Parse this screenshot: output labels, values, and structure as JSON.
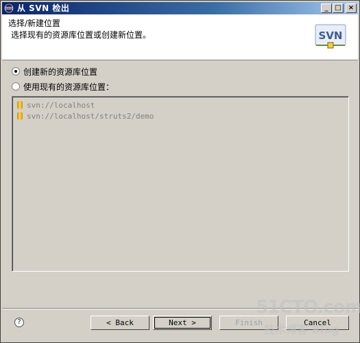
{
  "window": {
    "title": "从 SVN 检出",
    "controls": {
      "minimize": "_",
      "maximize": "□",
      "close": "×"
    }
  },
  "header": {
    "title": "选择/新建位置",
    "description": "选择现有的资源库位置或创建新位置。",
    "logo_text": "SVN"
  },
  "options": {
    "create_new": {
      "label": "创建新的资源库位置",
      "checked": true
    },
    "use_existing": {
      "label": "使用现有的资源库位置：",
      "checked": false
    }
  },
  "repositories": [
    {
      "url": "svn://localhost",
      "icon": "database-icon"
    },
    {
      "url": "svn://localhost/struts2/demo",
      "icon": "database-icon"
    }
  ],
  "buttons": {
    "help": "?",
    "back": "< Back",
    "next": "Next >",
    "finish": "Finish",
    "cancel": "Cancel"
  },
  "watermark": {
    "main": "51CTO.com",
    "sub": "技术博客 Blog"
  },
  "colors": {
    "titlebar_start": "#0a246a",
    "titlebar_end": "#a6caf0",
    "face": "#d4d0c8",
    "disabled_text": "#808080"
  }
}
